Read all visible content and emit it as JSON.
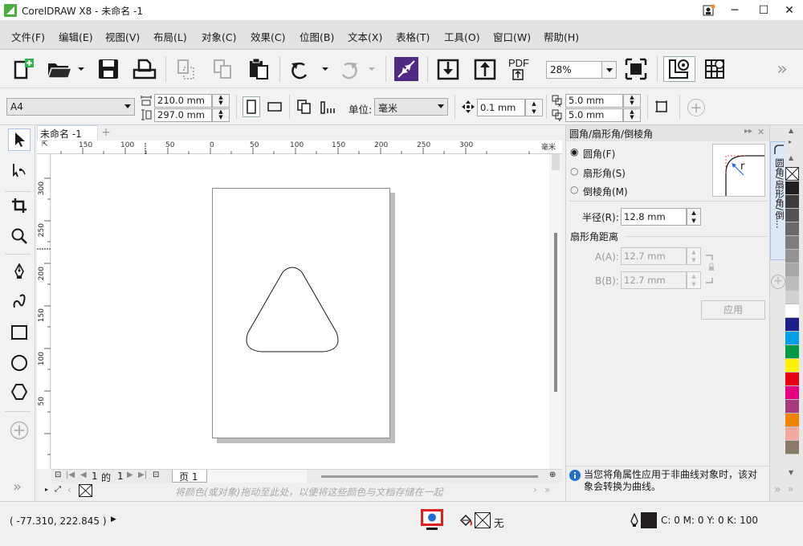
{
  "window": {
    "title": "CorelDRAW X8 - 未命名 -1"
  },
  "menu": [
    "文件(F)",
    "编辑(E)",
    "视图(V)",
    "布局(L)",
    "对象(C)",
    "效果(C)",
    "位图(B)",
    "文本(X)",
    "表格(T)",
    "工具(O)",
    "窗口(W)",
    "帮助(H)"
  ],
  "toolbar": {
    "zoom": "28%"
  },
  "propbar": {
    "paper": "A4",
    "width": "210.0 mm",
    "height": "297.0 mm",
    "unit_label": "单位:",
    "unit": "毫米",
    "nudge": "0.1 mm",
    "dup_x": "5.0 mm",
    "dup_y": "5.0 mm"
  },
  "document": {
    "tab": "未命名 -1",
    "ruler_h": [
      "150",
      "100",
      "50",
      "0",
      "50",
      "100",
      "150",
      "200",
      "250",
      "300"
    ],
    "ruler_h_unit": "毫米",
    "ruler_v": [
      "300",
      "250",
      "200",
      "150",
      "100",
      "50"
    ],
    "page_num": "1",
    "page_of": "的",
    "page_total": "1",
    "page_tab": "页 1",
    "palette_hint": "将颜色(或对象)拖动至此处，以便将这些颜色与文档存储在一起"
  },
  "docker": {
    "title": "圆角/扇形角/倒棱角",
    "options": [
      "圆角(F)",
      "扇形角(S)",
      "倒棱角(M)"
    ],
    "selected": 0,
    "radius_label": "半径(R):",
    "radius_value": "12.8 mm",
    "dist_title": "扇形角距离",
    "a_label": "A(A):",
    "a_value": "12.7 mm",
    "b_label": "B(B):",
    "b_value": "12.7 mm",
    "apply": "应用",
    "preview_letter": "r",
    "info": "当您将角属性应用于非曲线对象时，该对象会转换为曲线。",
    "vtab": "圆角/扇形角/倒..."
  },
  "palette": [
    "#231f20",
    "#3d3b3c",
    "#555353",
    "#6a6868",
    "#7f7d7d",
    "#949292",
    "#a9a7a7",
    "#bdbbbb",
    "#d2d0d0",
    "#ffffff",
    "#1d2088",
    "#00a0e9",
    "#009944",
    "#fff100",
    "#e60012",
    "#e4007f",
    "#a7397d",
    "#f08300",
    "#f4a99d",
    "#8a7a6a"
  ],
  "status": {
    "coords": "( -77.310, 222.845 )",
    "fill_none": "无",
    "outline": "C: 0 M: 0 Y: 0 K: 100"
  }
}
